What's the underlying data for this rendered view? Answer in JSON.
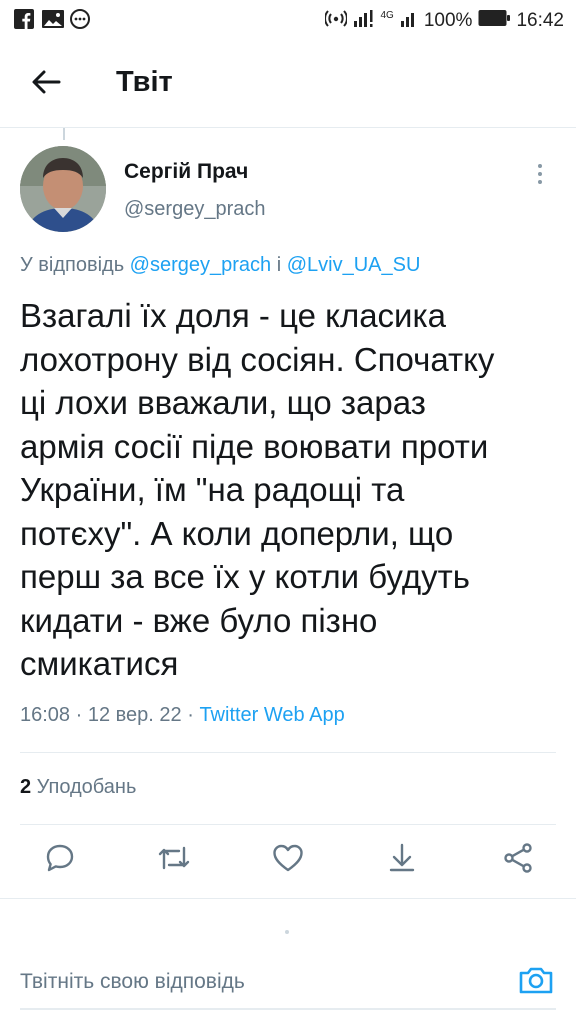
{
  "status_bar": {
    "battery_percent": "100%",
    "time": "16:42",
    "network": "4G",
    "left_icons": [
      "facebook-icon",
      "gallery-icon",
      "more-notifications-icon"
    ]
  },
  "header": {
    "title": "Твіт"
  },
  "tweet": {
    "author_name": "Сергій Прач",
    "author_handle": "@sergey_prach",
    "reply_prefix": "У відповідь ",
    "reply_to_1": "@sergey_prach",
    "reply_joiner": " і ",
    "reply_to_2": "@Lviv_UA_SU",
    "text": "Взагалі їх доля - це класика\nлохотрону від сосіян. Спочатку\nці лохи вважали, що зараз\nармія сосії піде воювати проти\nУкраїни, їм \"на радощі та\nпотєху\". А коли доперли, що\nперш за все їх у котли будуть\nкидати - вже було пізно\nсмикатися",
    "time": "16:08",
    "date": "12 вер. 22",
    "meta_sep": " · ",
    "source_app": "Twitter Web App",
    "likes_count": "2",
    "likes_label": " Уподобань"
  },
  "actions": [
    "reply-icon",
    "retweet-icon",
    "like-icon",
    "bookmark-icon",
    "share-icon"
  ],
  "composer": {
    "placeholder": "Твітніть свою відповідь"
  },
  "colors": {
    "accent": "#1da1f2",
    "secondary_text": "#657786",
    "primary_text": "#14171a",
    "divider": "#e6ecf0"
  }
}
